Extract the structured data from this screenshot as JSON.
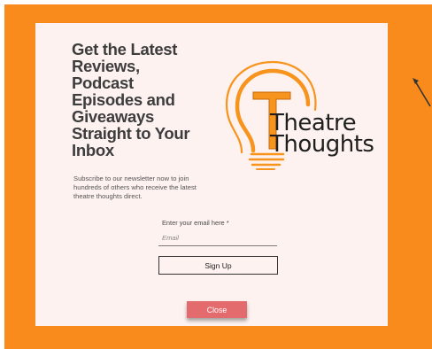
{
  "colors": {
    "backdrop": "#f98b1c",
    "modal_background": "#fdf2ef",
    "logo_accent": "#f7941d",
    "close_button": "#e36a6d"
  },
  "popup": {
    "headline": "Get the Latest Reviews, Podcast Episodes and Giveaways Straight to Your Inbox",
    "subtext": "Subscribe to our newsletter now to join hundreds of others who receive the latest theatre thoughts direct.",
    "logo": {
      "line1": "Theatre",
      "line2": "Thoughts",
      "icon": "lightbulb-icon"
    },
    "email": {
      "label": "Enter your email here *",
      "placeholder": "Email",
      "value": ""
    },
    "signup_label": "Sign Up",
    "close_label": "Close"
  },
  "pointer_icon": "arrow-cursor-icon"
}
